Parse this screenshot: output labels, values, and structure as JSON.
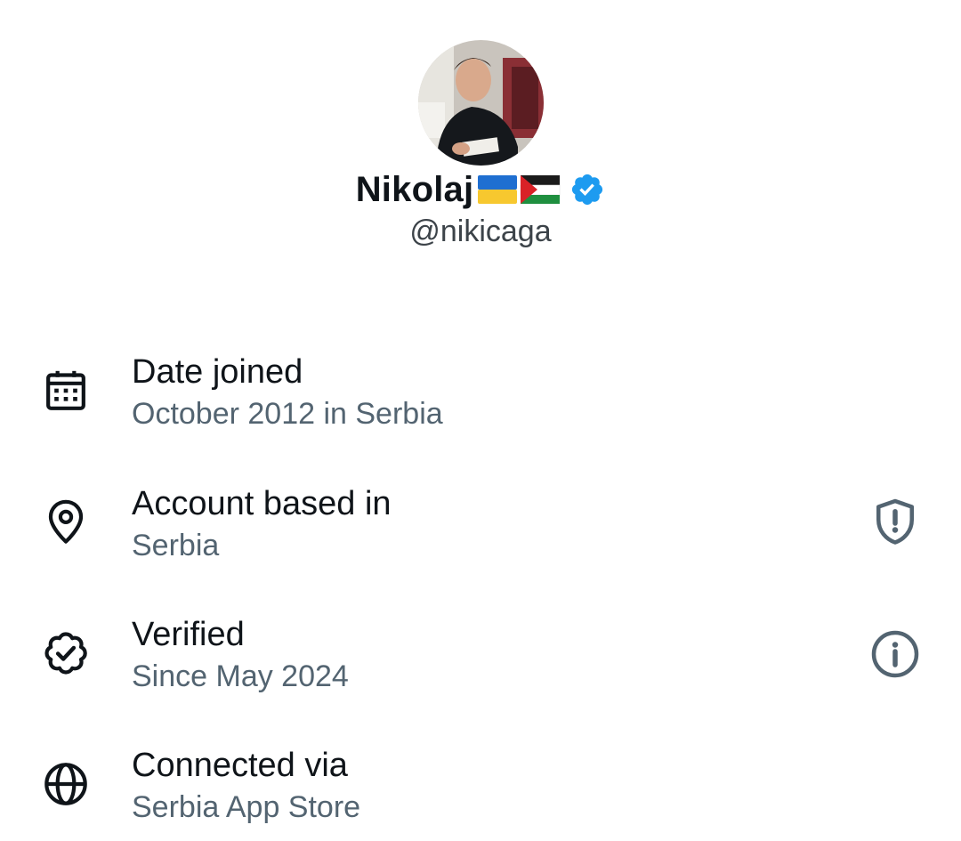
{
  "profile": {
    "display_name": "Nikolaj",
    "handle": "@nikicaga",
    "flags": [
      "ukraine-flag",
      "palestine-flag"
    ],
    "verified_icon": "verified-badge-icon",
    "verified_color": "#1d9bf0"
  },
  "about_rows": [
    {
      "icon": "calendar-icon",
      "title": "Date joined",
      "subtitle": "October 2012 in Serbia"
    },
    {
      "icon": "location-pin-icon",
      "title": "Account based in",
      "subtitle": "Serbia",
      "action_icon": "shield-alert-icon"
    },
    {
      "icon": "verified-check-icon",
      "title": "Verified",
      "subtitle": "Since May 2024",
      "action_icon": "info-icon"
    },
    {
      "icon": "globe-icon",
      "title": "Connected via",
      "subtitle": "Serbia App Store"
    }
  ],
  "colors": {
    "primary_text": "#0f1419",
    "secondary_text": "#536471",
    "accent": "#1d9bf0",
    "background": "#ffffff"
  }
}
